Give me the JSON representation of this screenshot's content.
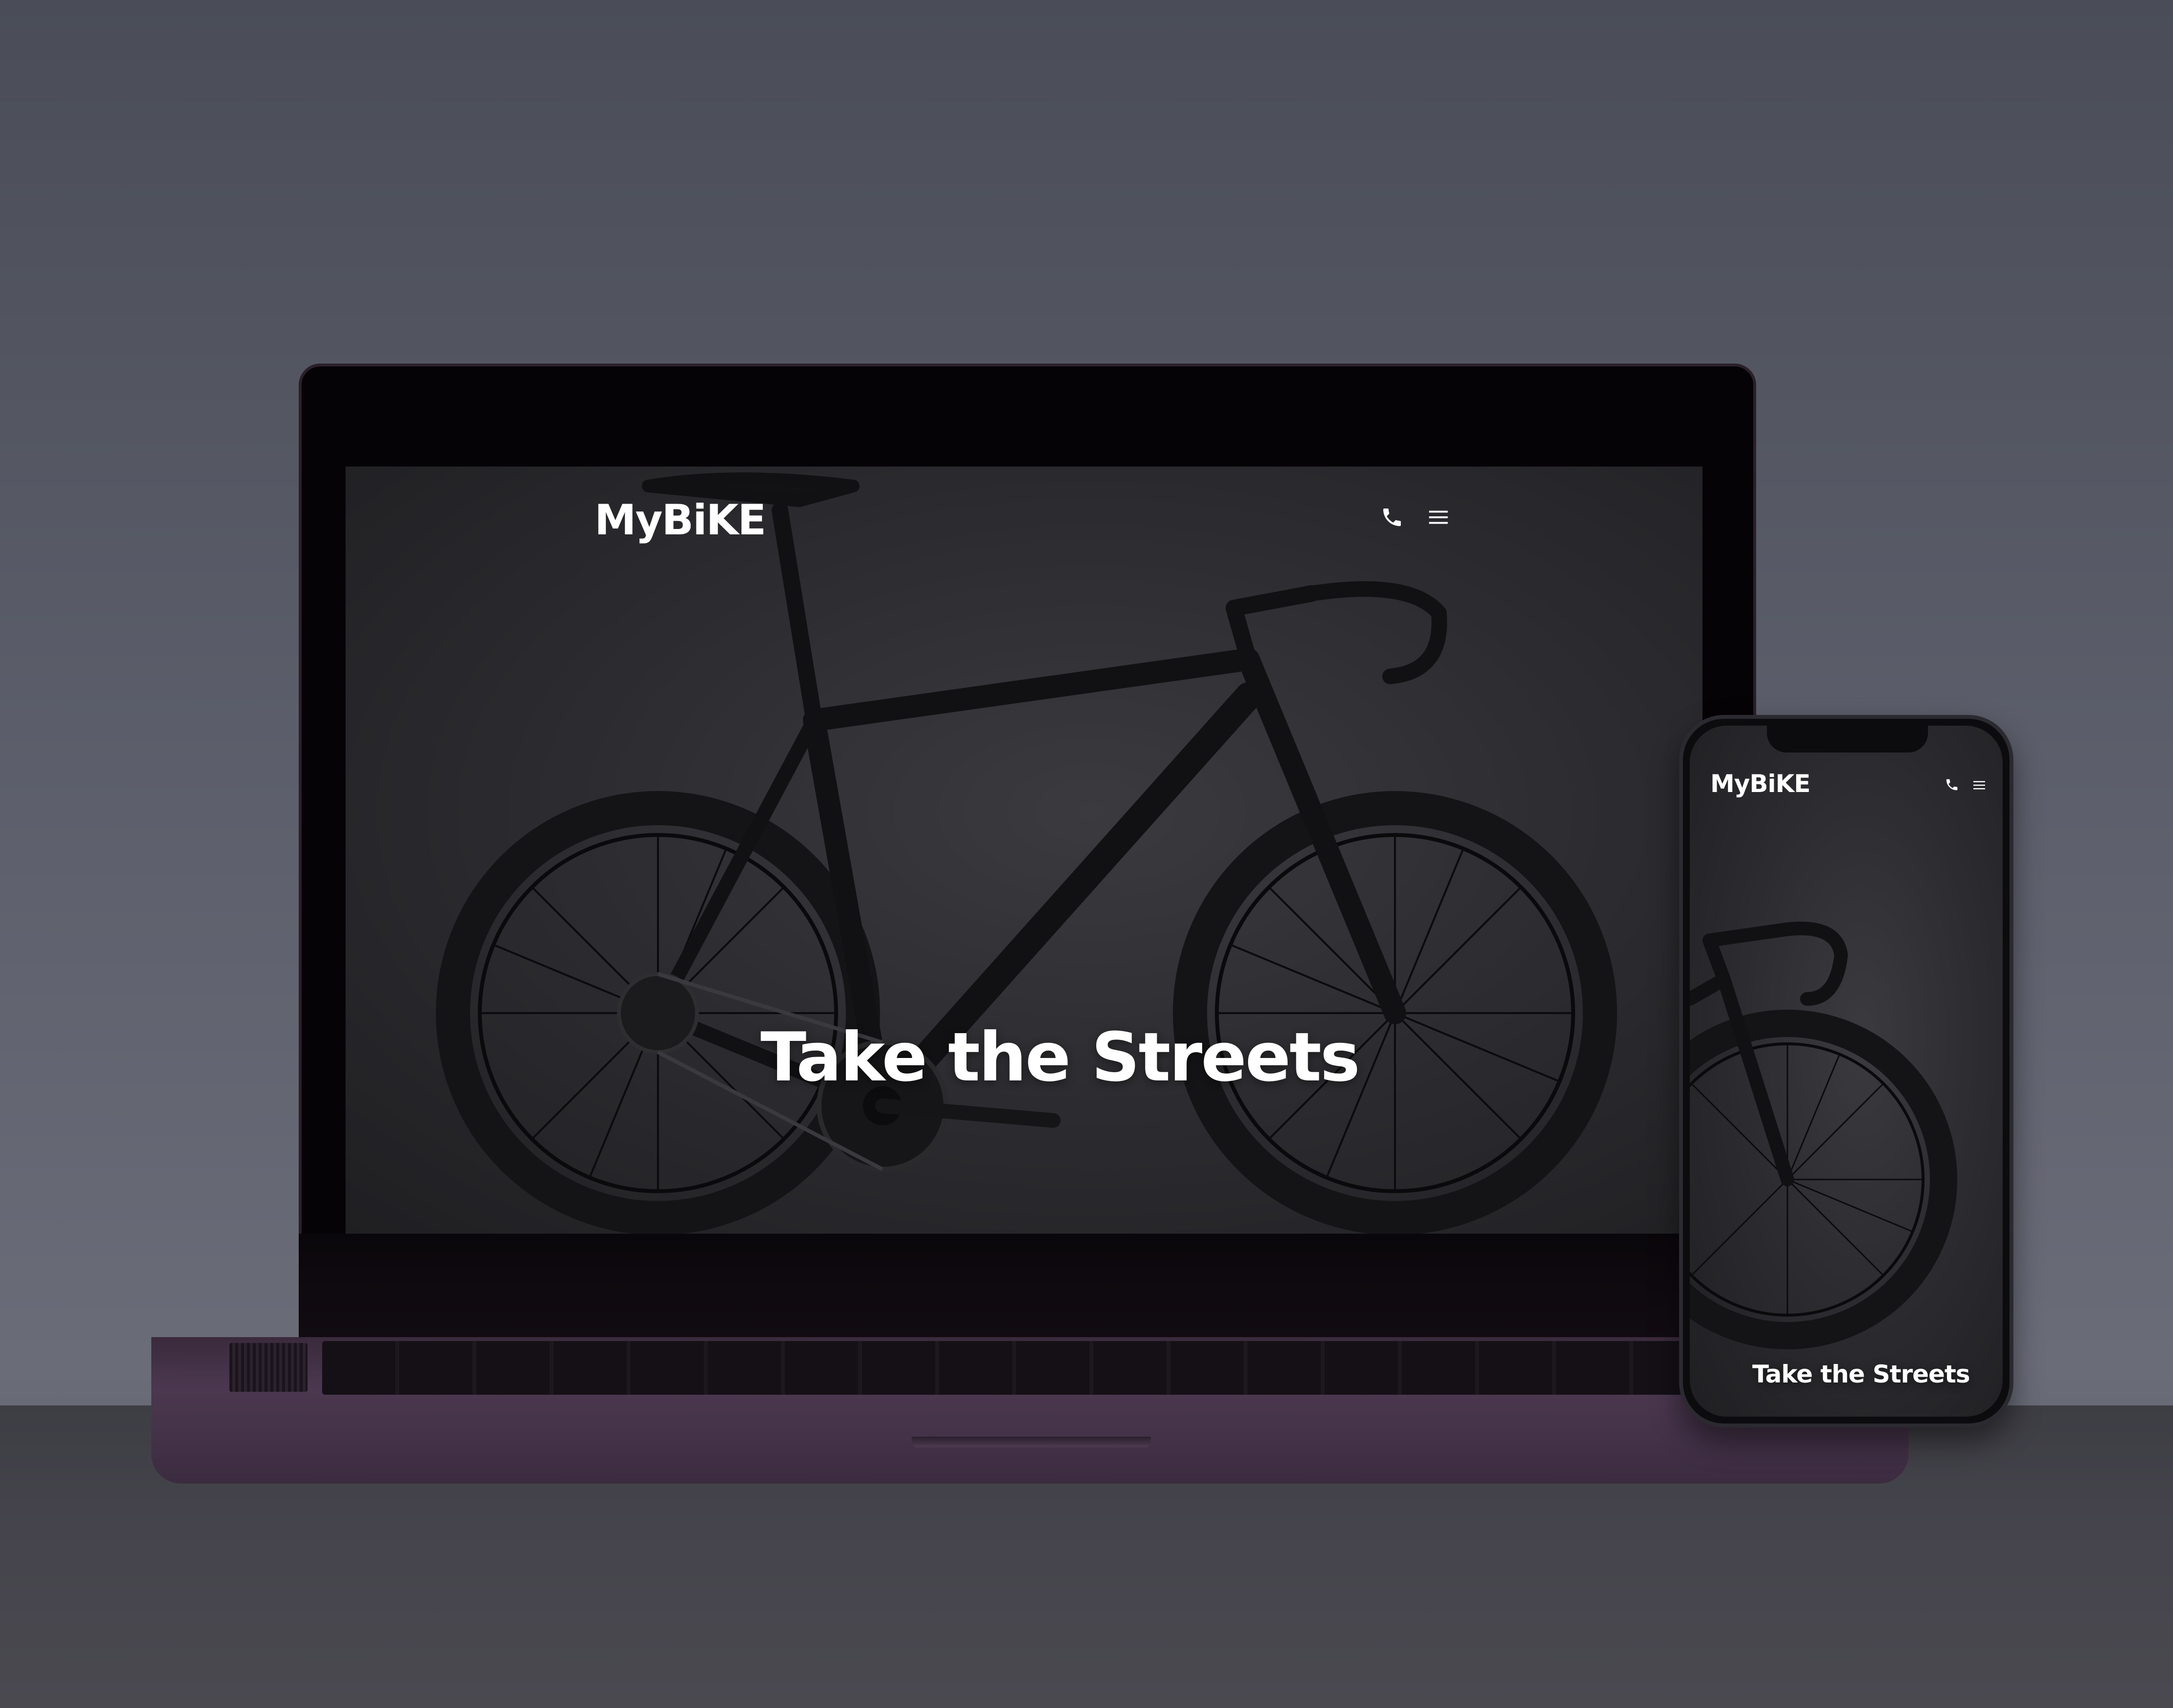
{
  "site": {
    "brand": "MyBiKE",
    "headline": "Take the Streets"
  },
  "icons": {
    "phone": "phone-icon",
    "menu": "hamburger-menu-icon"
  },
  "colors": {
    "background": "#5c5f6b",
    "text": "#ffffff",
    "laptop_body": "#4b3850",
    "hero_background": "#2c2c30"
  }
}
